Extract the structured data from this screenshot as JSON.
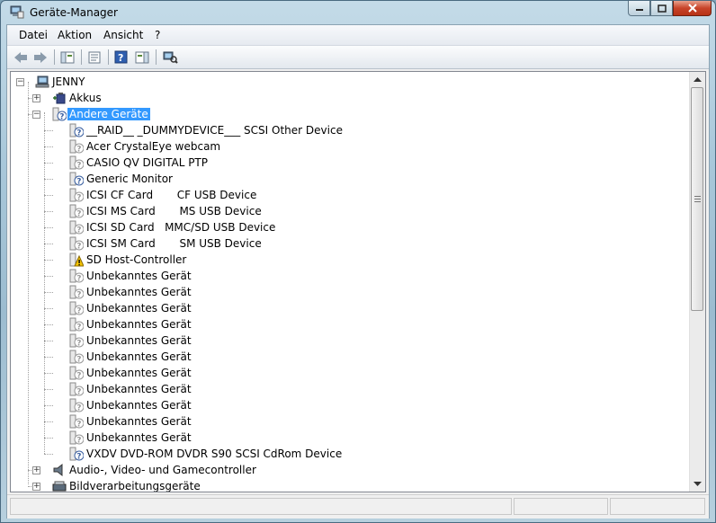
{
  "window": {
    "title": "Geräte-Manager"
  },
  "menu": [
    "Datei",
    "Aktion",
    "Ansicht",
    "?"
  ],
  "toolbar": {
    "buttons": [
      "back-arrow-icon",
      "forward-arrow-icon",
      "console-tree-icon",
      "properties-icon",
      "help-icon",
      "action-pane-icon",
      "scan-hardware-icon"
    ]
  },
  "tree": {
    "root": "JENNY",
    "categories": [
      {
        "label": "Akkus",
        "icon": "battery-icon",
        "expanded": false
      },
      {
        "label": "Andere Geräte",
        "icon": "unknown-device-icon",
        "expanded": true,
        "selected": true,
        "children": [
          {
            "label": "__RAID__ _DUMMYDEVICE___ SCSI Other Device",
            "icon": "unknown-device-icon"
          },
          {
            "label": "Acer CrystalEye webcam",
            "icon": "unknown-device-icon"
          },
          {
            "label": "CASIO QV DIGITAL PTP",
            "icon": "unknown-device-icon"
          },
          {
            "label": "Generic Monitor",
            "icon": "unknown-device-icon"
          },
          {
            "label": "ICSI CF Card       CF USB Device",
            "icon": "unknown-device-icon"
          },
          {
            "label": "ICSI MS Card       MS USB Device",
            "icon": "unknown-device-icon"
          },
          {
            "label": "ICSI SD Card   MMC/SD USB Device",
            "icon": "unknown-device-icon"
          },
          {
            "label": "ICSI SM Card       SM USB Device",
            "icon": "unknown-device-icon"
          },
          {
            "label": "SD Host-Controller",
            "icon": "warning-device-icon"
          },
          {
            "label": "Unbekanntes Gerät",
            "icon": "unknown-device-icon"
          },
          {
            "label": "Unbekanntes Gerät",
            "icon": "unknown-device-icon"
          },
          {
            "label": "Unbekanntes Gerät",
            "icon": "unknown-device-icon"
          },
          {
            "label": "Unbekanntes Gerät",
            "icon": "unknown-device-icon"
          },
          {
            "label": "Unbekanntes Gerät",
            "icon": "unknown-device-icon"
          },
          {
            "label": "Unbekanntes Gerät",
            "icon": "unknown-device-icon"
          },
          {
            "label": "Unbekanntes Gerät",
            "icon": "unknown-device-icon"
          },
          {
            "label": "Unbekanntes Gerät",
            "icon": "unknown-device-icon"
          },
          {
            "label": "Unbekanntes Gerät",
            "icon": "unknown-device-icon"
          },
          {
            "label": "Unbekanntes Gerät",
            "icon": "unknown-device-icon"
          },
          {
            "label": "Unbekanntes Gerät",
            "icon": "unknown-device-icon"
          },
          {
            "label": "VXDV DVD-ROM DVDR S90 SCSI CdRom Device",
            "icon": "unknown-device-icon"
          }
        ]
      },
      {
        "label": "Audio-, Video- und Gamecontroller",
        "icon": "speaker-icon",
        "expanded": false
      },
      {
        "label": "Bildverarbeitungsgeräte",
        "icon": "scanner-icon",
        "expanded": false
      }
    ]
  },
  "colors": {
    "selection": "#3399ff",
    "warning": "#f5c400",
    "close_button": "#c8442a"
  }
}
